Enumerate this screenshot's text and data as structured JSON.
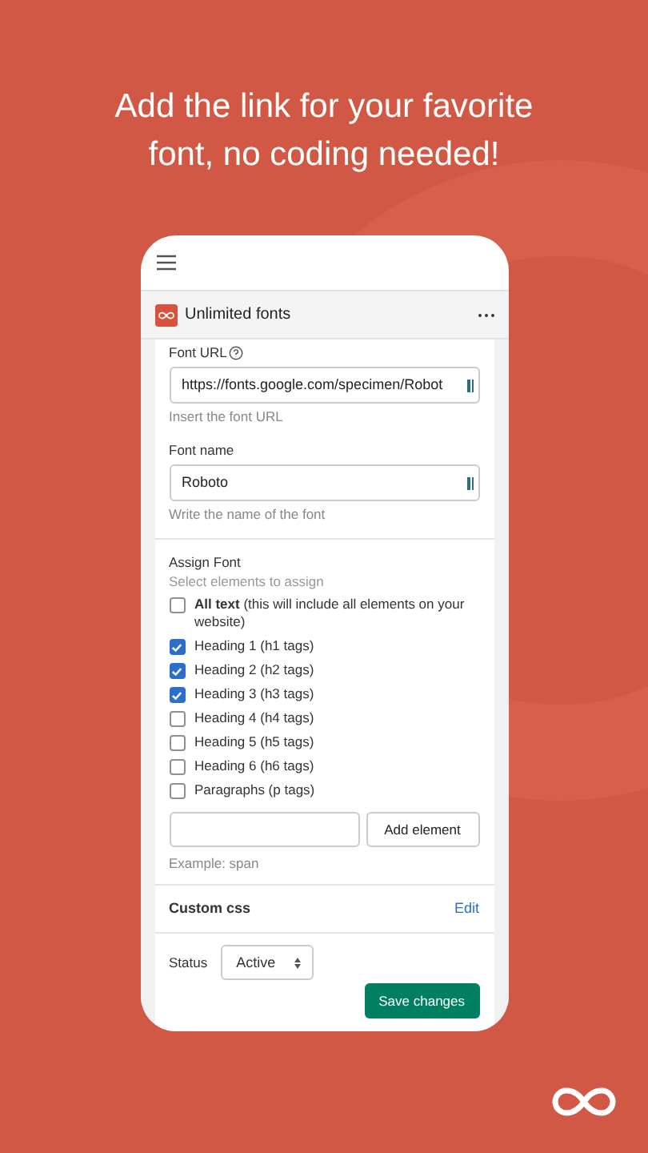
{
  "headline": "Add the link for your favorite font, no coding needed!",
  "app": {
    "title": "Unlimited fonts"
  },
  "font_url": {
    "label": "Font URL",
    "value": "https://fonts.google.com/specimen/Robot",
    "help": "Insert the font URL"
  },
  "font_name": {
    "label": "Font name",
    "value": "Roboto",
    "help": "Write the name of the font"
  },
  "assign": {
    "title": "Assign Font",
    "subtitle": "Select elements to assign",
    "options": [
      {
        "label": "**All text** (this will include all elements on your website)",
        "checked": false
      },
      {
        "label": "Heading 1 (h1 tags)",
        "checked": true
      },
      {
        "label": "Heading 2 (h2 tags)",
        "checked": true
      },
      {
        "label": "Heading 3 (h3 tags)",
        "checked": true
      },
      {
        "label": "Heading 4 (h4 tags)",
        "checked": false
      },
      {
        "label": "Heading 5 (h5 tags)",
        "checked": false
      },
      {
        "label": "Heading 6 (h6 tags)",
        "checked": false
      },
      {
        "label": "Paragraphs (p tags)",
        "checked": false
      }
    ],
    "add_button": "Add element",
    "example": "Example: span"
  },
  "custom_css": {
    "title": "Custom css",
    "action": "Edit"
  },
  "status": {
    "label": "Status",
    "value": "Active"
  },
  "save_button": "Save changes"
}
